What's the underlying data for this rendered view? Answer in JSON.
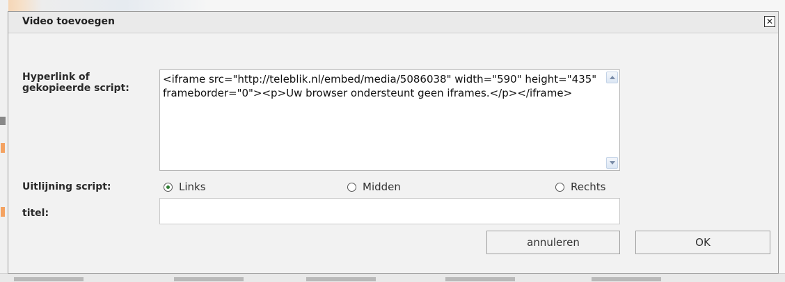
{
  "dialog": {
    "title": "Video toevoegen",
    "close_symbol": "✕"
  },
  "form": {
    "script_label_line1": "Hyperlink of",
    "script_label_line2": "gekopieerde script:",
    "script_value": "<iframe src=\"http://teleblik.nl/embed/media/5086038\" width=\"590\" height=\"435\" frameborder=\"0\"><p>Uw browser ondersteunt geen iframes.</p></iframe>",
    "alignment_label": "Uitlijning script:",
    "alignment_options": [
      {
        "label": "Links",
        "selected": true
      },
      {
        "label": "Midden",
        "selected": false
      },
      {
        "label": "Rechts",
        "selected": false
      }
    ],
    "title_label": "titel:",
    "title_value": ""
  },
  "buttons": {
    "cancel_label": "annuleren",
    "ok_label": "OK"
  },
  "colors": {
    "radio_selected": "#2e7d32",
    "dialog_bg": "#f2f2f2"
  }
}
